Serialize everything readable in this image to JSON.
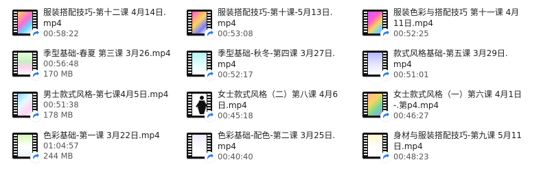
{
  "files": [
    {
      "name_line1": "服装搭配技巧-第十二课 4月14日.",
      "name_line2": "mp4",
      "duration": "00:58:22",
      "size": "",
      "thumb_color": "#ffd35c"
    },
    {
      "name_line1": "服装搭配技巧-第十课-5月13日.",
      "name_line2": "mp4",
      "duration": "00:53:08",
      "size": "",
      "thumb_color": "#ff5bd0"
    },
    {
      "name_line1": "服装色彩与搭配技巧 第十一课 4月",
      "name_line2": "11日.mp4",
      "duration": "00:52:25",
      "size": "",
      "thumb_color": "#d357ff"
    },
    {
      "name_line1": "季型基础-春夏 第三课 3月26.mp4",
      "name_line2": "",
      "duration": "00:56:48",
      "size": "170 MB",
      "thumb_color": "#c7f0c2"
    },
    {
      "name_line1": "季型基础-秋冬-第四课  3月27日.",
      "name_line2": "mp4",
      "duration": "00:52:17",
      "size": "",
      "thumb_color": "#b7f5f0"
    },
    {
      "name_line1": "款式风格基础-第五课  3月29日.",
      "name_line2": "mp4",
      "duration": "00:51:01",
      "size": "",
      "thumb_color": "#b7b9ff"
    },
    {
      "name_line1": "男士款式风格-第七课4月5日.mp4",
      "name_line2": "",
      "duration": "00:51:38",
      "size": "178 MB",
      "thumb_color": "#8ad7ff"
    },
    {
      "name_line1": "女士款式风格（二）第八课  4月6",
      "name_line2": "日.mp4",
      "duration": "00:45:18",
      "size": "",
      "thumb_color": "#ffffff"
    },
    {
      "name_line1": "女士款式风格（一）第六课 4月1日",
      "name_line2": "-.第p4.mp4",
      "duration": "00:46:27",
      "size": "",
      "thumb_color": "#ffb3ad"
    },
    {
      "name_line1": "色彩基础-第一课 3月22日.mp4",
      "name_line2": "",
      "duration": "01:04:57",
      "size": "244 MB",
      "thumb_color": "#d9f7b8"
    },
    {
      "name_line1": "色彩基础-配色-第二课 3月25日.",
      "name_line2": "mp4",
      "duration": "00:40:40",
      "size": "",
      "thumb_color": "#efe7ff"
    },
    {
      "name_line1": "身材与服装搭配技巧-第九课 5月11",
      "name_line2": "日.mp4",
      "duration": "00:48:23",
      "size": "",
      "thumb_color": "#fff7cf"
    }
  ]
}
